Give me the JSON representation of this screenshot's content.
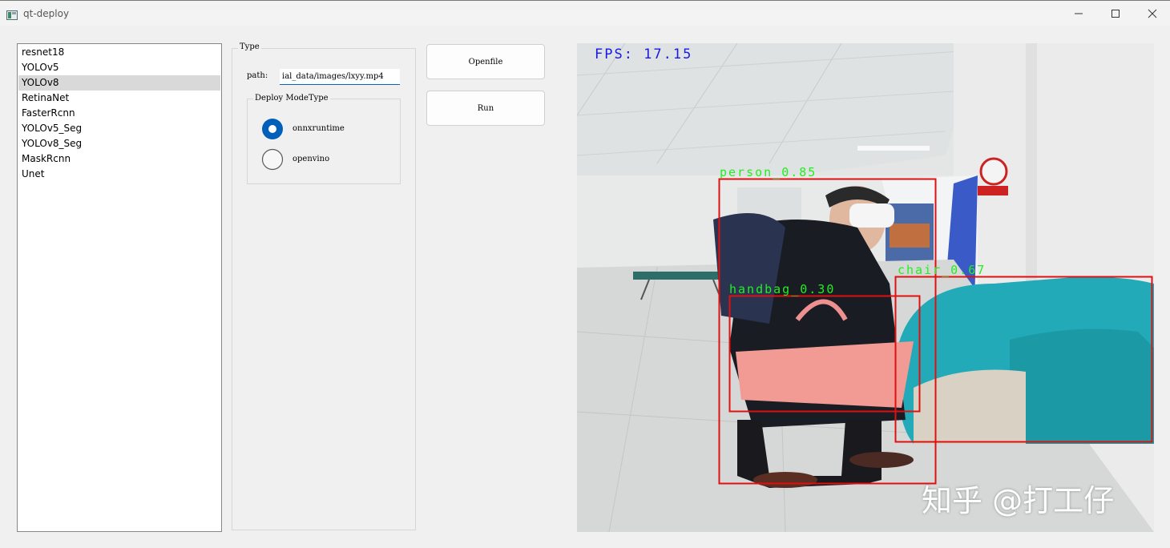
{
  "window": {
    "title": "qt-deploy",
    "icons": {
      "app": "app-icon",
      "minimize": "minimize-icon",
      "maximize": "maximize-icon",
      "close": "close-icon"
    }
  },
  "models": [
    {
      "label": "resnet18",
      "selected": false
    },
    {
      "label": "YOLOv5",
      "selected": false
    },
    {
      "label": "YOLOv8",
      "selected": true
    },
    {
      "label": "RetinaNet",
      "selected": false
    },
    {
      "label": "FasterRcnn",
      "selected": false
    },
    {
      "label": "YOLOv5_Seg",
      "selected": false
    },
    {
      "label": "YOLOv8_Seg",
      "selected": false
    },
    {
      "label": "MaskRcnn",
      "selected": false
    },
    {
      "label": "Unet",
      "selected": false
    }
  ],
  "type_group": {
    "title": "Type",
    "path_label": "path:",
    "path_value": "ial_data/images/lxyy.mp4",
    "mode_group": {
      "title": "Deploy ModeType",
      "options": [
        {
          "label": "onnxruntime",
          "checked": true
        },
        {
          "label": "openvino",
          "checked": false
        }
      ]
    }
  },
  "buttons": {
    "openfile": "Openfile",
    "run": "Run"
  },
  "video": {
    "fps_text": "FPS: 17.15",
    "detections": [
      {
        "label": "person_0.85"
      },
      {
        "label": "handbag_0.30"
      },
      {
        "label": "chair_0.67"
      }
    ],
    "watermark": "知乎 @打工仔",
    "colors": {
      "box": "#e01010",
      "label": "#22ee22",
      "fps": "#1818e8"
    }
  }
}
